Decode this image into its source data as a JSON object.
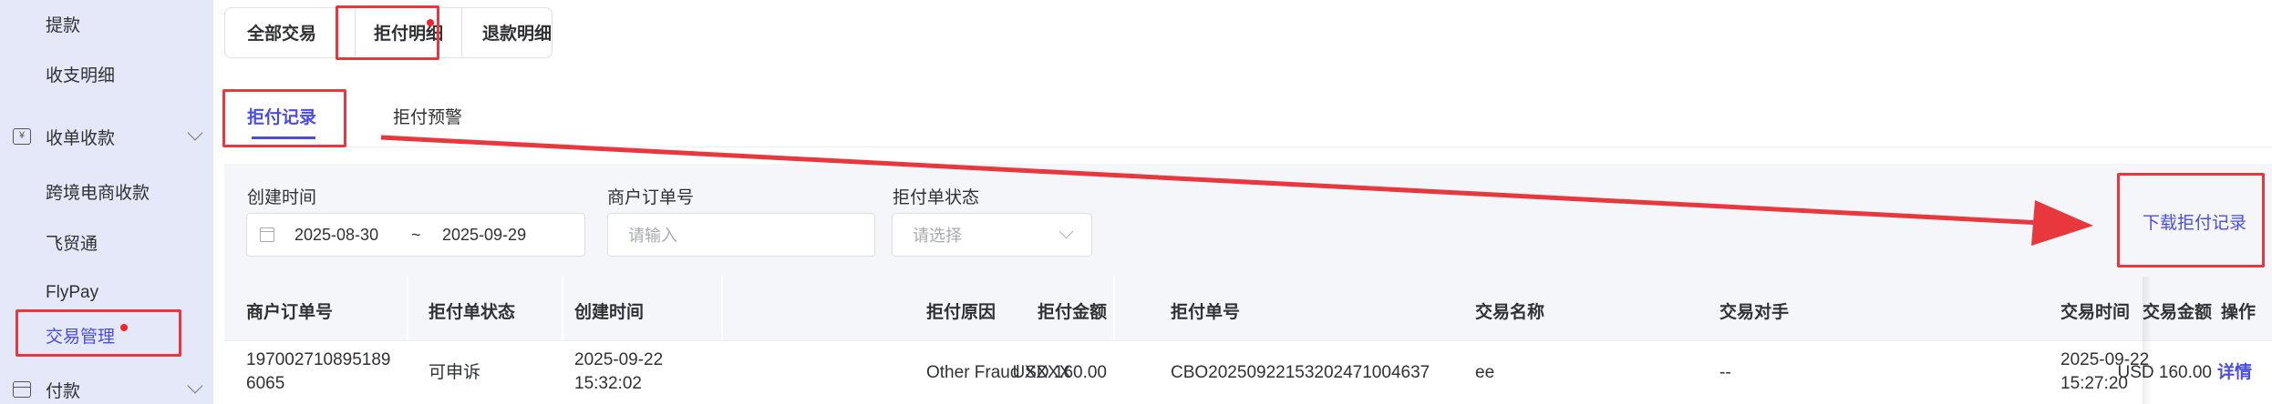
{
  "sidebar": {
    "items": [
      {
        "label": "提款",
        "type": "sub"
      },
      {
        "label": "收支明细",
        "type": "sub"
      },
      {
        "label": "收单收款",
        "type": "group",
        "icon": "yen-receipt-icon"
      },
      {
        "label": "跨境电商收款",
        "type": "sub"
      },
      {
        "label": "飞贸通",
        "type": "sub"
      },
      {
        "label": "FlyPay",
        "type": "sub"
      },
      {
        "label": "交易管理",
        "type": "sub",
        "active": true
      },
      {
        "label": "付款",
        "type": "group",
        "icon": "card-icon"
      }
    ],
    "yen_glyph": "¥"
  },
  "top_tabs": [
    {
      "label": "全部交易"
    },
    {
      "label": "拒付明细",
      "active": true
    },
    {
      "label": "退款明细"
    }
  ],
  "sub_tabs": [
    {
      "label": "拒付记录",
      "active": true
    },
    {
      "label": "拒付预警"
    }
  ],
  "filters": {
    "created_time": {
      "label": "创建时间",
      "start": "2025-08-30",
      "separator": "~",
      "end": "2025-09-29"
    },
    "merchant_order": {
      "label": "商户订单号",
      "placeholder": "请输入"
    },
    "chargeback_status": {
      "label": "拒付单状态",
      "placeholder": "请选择"
    },
    "download_label": "下载拒付记录"
  },
  "table": {
    "columns": [
      "商户订单号",
      "拒付单状态",
      "创建时间",
      "拒付金额",
      "拒付原因",
      "拒付单号",
      "交易名称",
      "交易对手",
      "交易金额",
      "交易时间",
      "操作"
    ],
    "rows": [
      {
        "merchant_order_line1": "197002710895189",
        "merchant_order_line2": "6065",
        "status": "可申诉",
        "created_date": "2025-09-22",
        "created_time": "15:32:02",
        "amount": "USD 160.00",
        "reason": "Other Fraud XXXX",
        "chargeback_no": "CBO20250922153202471004637",
        "trade_name": "ee",
        "counterparty": "--",
        "trade_amount": "USD 160.00",
        "trade_date": "2025-09-22",
        "trade_time": "15:27:20",
        "action": "详情"
      }
    ]
  },
  "colors": {
    "accent": "#4b4de0",
    "annotation_red": "#e8383d",
    "sidebar_bg": "#e4e8f8",
    "badge_red": "#f5222d"
  }
}
